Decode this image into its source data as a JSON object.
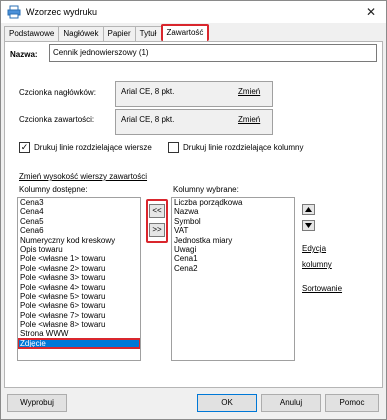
{
  "window": {
    "title": "Wzorzec wydruku",
    "close_glyph": "✕"
  },
  "tabs": [
    {
      "label": "Podstawowe"
    },
    {
      "label": "Nagłówek"
    },
    {
      "label": "Papier"
    },
    {
      "label": "Tytuł"
    },
    {
      "label": "Zawartość",
      "active": true
    }
  ],
  "name": {
    "label": "Nazwa:",
    "value": "Cennik jednowierszowy (1)"
  },
  "fonts": {
    "header_label": "Czcionka nagłówków:",
    "header_value": "Arial CE, 8 pkt.",
    "header_change": "Zmień",
    "content_label": "Czcionka zawartości:",
    "content_value": "Arial CE, 8 pkt.",
    "content_change": "Zmień"
  },
  "checkboxes": {
    "row_lines_label": "Drukuj linie rozdzielające wiersze",
    "row_lines_checked": true,
    "col_lines_label": "Drukuj linie rozdzielające kolumny",
    "col_lines_checked": false
  },
  "row_height_link": "Zmień wysokość wierszy zawartości",
  "available": {
    "label": "Kolumny dostępne:",
    "items": [
      "Cena3",
      "Cena4",
      "Cena5",
      "Cena6",
      "Numeryczny kod kreskowy",
      "Opis towaru",
      "Pole <własne 1> towaru",
      "Pole <własne 2> towaru",
      "Pole <własne 3> towaru",
      "Pole <własne 4> towaru",
      "Pole <własne 5> towaru",
      "Pole <własne 6> towaru",
      "Pole <własne 7> towaru",
      "Pole <własne 8> towaru",
      "Strona WWW",
      "Zdjęcie"
    ],
    "selected_index": 15
  },
  "move_buttons": {
    "remove": "<<",
    "add": ">>"
  },
  "chosen": {
    "label": "Kolumny wybrane:",
    "items": [
      "Liczba porządkowa",
      "Nazwa",
      "Symbol",
      "VAT",
      "Jednostka miary",
      "Uwagi",
      "Cena1",
      "Cena2"
    ]
  },
  "side_links": {
    "edit_line1": "Edycja",
    "edit_line2": "kolumny",
    "sort": "Sortowanie"
  },
  "footer": {
    "print": "Wyprobuj",
    "ok": "OK",
    "cancel": "Anuluj",
    "help": "Pomoc"
  },
  "icons": {
    "app": "printer-icon",
    "up": "up-arrow-icon",
    "down": "down-arrow-icon"
  },
  "colors": {
    "highlight": "#d9262d",
    "selection": "#0078d7"
  }
}
